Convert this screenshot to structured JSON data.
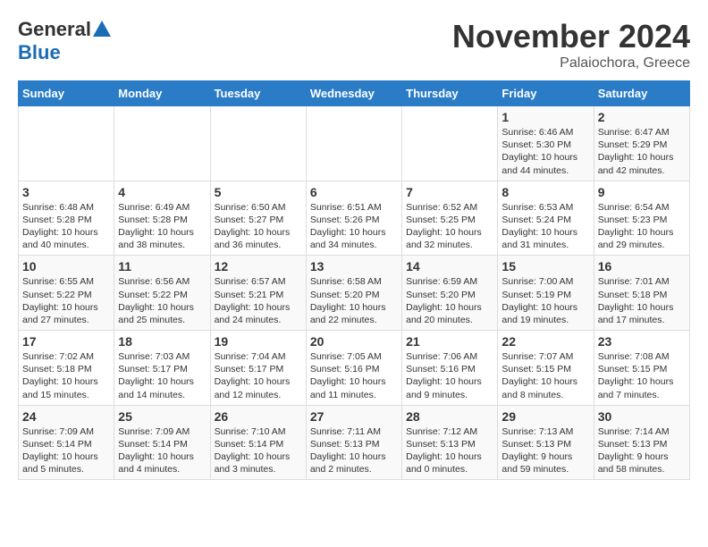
{
  "logo": {
    "general": "General",
    "blue": "Blue"
  },
  "title": "November 2024",
  "location": "Palaiochora, Greece",
  "days_of_week": [
    "Sunday",
    "Monday",
    "Tuesday",
    "Wednesday",
    "Thursday",
    "Friday",
    "Saturday"
  ],
  "weeks": [
    [
      {
        "day": "",
        "info": ""
      },
      {
        "day": "",
        "info": ""
      },
      {
        "day": "",
        "info": ""
      },
      {
        "day": "",
        "info": ""
      },
      {
        "day": "",
        "info": ""
      },
      {
        "day": "1",
        "info": "Sunrise: 6:46 AM\nSunset: 5:30 PM\nDaylight: 10 hours\nand 44 minutes."
      },
      {
        "day": "2",
        "info": "Sunrise: 6:47 AM\nSunset: 5:29 PM\nDaylight: 10 hours\nand 42 minutes."
      }
    ],
    [
      {
        "day": "3",
        "info": "Sunrise: 6:48 AM\nSunset: 5:28 PM\nDaylight: 10 hours\nand 40 minutes."
      },
      {
        "day": "4",
        "info": "Sunrise: 6:49 AM\nSunset: 5:28 PM\nDaylight: 10 hours\nand 38 minutes."
      },
      {
        "day": "5",
        "info": "Sunrise: 6:50 AM\nSunset: 5:27 PM\nDaylight: 10 hours\nand 36 minutes."
      },
      {
        "day": "6",
        "info": "Sunrise: 6:51 AM\nSunset: 5:26 PM\nDaylight: 10 hours\nand 34 minutes."
      },
      {
        "day": "7",
        "info": "Sunrise: 6:52 AM\nSunset: 5:25 PM\nDaylight: 10 hours\nand 32 minutes."
      },
      {
        "day": "8",
        "info": "Sunrise: 6:53 AM\nSunset: 5:24 PM\nDaylight: 10 hours\nand 31 minutes."
      },
      {
        "day": "9",
        "info": "Sunrise: 6:54 AM\nSunset: 5:23 PM\nDaylight: 10 hours\nand 29 minutes."
      }
    ],
    [
      {
        "day": "10",
        "info": "Sunrise: 6:55 AM\nSunset: 5:22 PM\nDaylight: 10 hours\nand 27 minutes."
      },
      {
        "day": "11",
        "info": "Sunrise: 6:56 AM\nSunset: 5:22 PM\nDaylight: 10 hours\nand 25 minutes."
      },
      {
        "day": "12",
        "info": "Sunrise: 6:57 AM\nSunset: 5:21 PM\nDaylight: 10 hours\nand 24 minutes."
      },
      {
        "day": "13",
        "info": "Sunrise: 6:58 AM\nSunset: 5:20 PM\nDaylight: 10 hours\nand 22 minutes."
      },
      {
        "day": "14",
        "info": "Sunrise: 6:59 AM\nSunset: 5:20 PM\nDaylight: 10 hours\nand 20 minutes."
      },
      {
        "day": "15",
        "info": "Sunrise: 7:00 AM\nSunset: 5:19 PM\nDaylight: 10 hours\nand 19 minutes."
      },
      {
        "day": "16",
        "info": "Sunrise: 7:01 AM\nSunset: 5:18 PM\nDaylight: 10 hours\nand 17 minutes."
      }
    ],
    [
      {
        "day": "17",
        "info": "Sunrise: 7:02 AM\nSunset: 5:18 PM\nDaylight: 10 hours\nand 15 minutes."
      },
      {
        "day": "18",
        "info": "Sunrise: 7:03 AM\nSunset: 5:17 PM\nDaylight: 10 hours\nand 14 minutes."
      },
      {
        "day": "19",
        "info": "Sunrise: 7:04 AM\nSunset: 5:17 PM\nDaylight: 10 hours\nand 12 minutes."
      },
      {
        "day": "20",
        "info": "Sunrise: 7:05 AM\nSunset: 5:16 PM\nDaylight: 10 hours\nand 11 minutes."
      },
      {
        "day": "21",
        "info": "Sunrise: 7:06 AM\nSunset: 5:16 PM\nDaylight: 10 hours\nand 9 minutes."
      },
      {
        "day": "22",
        "info": "Sunrise: 7:07 AM\nSunset: 5:15 PM\nDaylight: 10 hours\nand 8 minutes."
      },
      {
        "day": "23",
        "info": "Sunrise: 7:08 AM\nSunset: 5:15 PM\nDaylight: 10 hours\nand 7 minutes."
      }
    ],
    [
      {
        "day": "24",
        "info": "Sunrise: 7:09 AM\nSunset: 5:14 PM\nDaylight: 10 hours\nand 5 minutes."
      },
      {
        "day": "25",
        "info": "Sunrise: 7:09 AM\nSunset: 5:14 PM\nDaylight: 10 hours\nand 4 minutes."
      },
      {
        "day": "26",
        "info": "Sunrise: 7:10 AM\nSunset: 5:14 PM\nDaylight: 10 hours\nand 3 minutes."
      },
      {
        "day": "27",
        "info": "Sunrise: 7:11 AM\nSunset: 5:13 PM\nDaylight: 10 hours\nand 2 minutes."
      },
      {
        "day": "28",
        "info": "Sunrise: 7:12 AM\nSunset: 5:13 PM\nDaylight: 10 hours\nand 0 minutes."
      },
      {
        "day": "29",
        "info": "Sunrise: 7:13 AM\nSunset: 5:13 PM\nDaylight: 9 hours\nand 59 minutes."
      },
      {
        "day": "30",
        "info": "Sunrise: 7:14 AM\nSunset: 5:13 PM\nDaylight: 9 hours\nand 58 minutes."
      }
    ]
  ]
}
